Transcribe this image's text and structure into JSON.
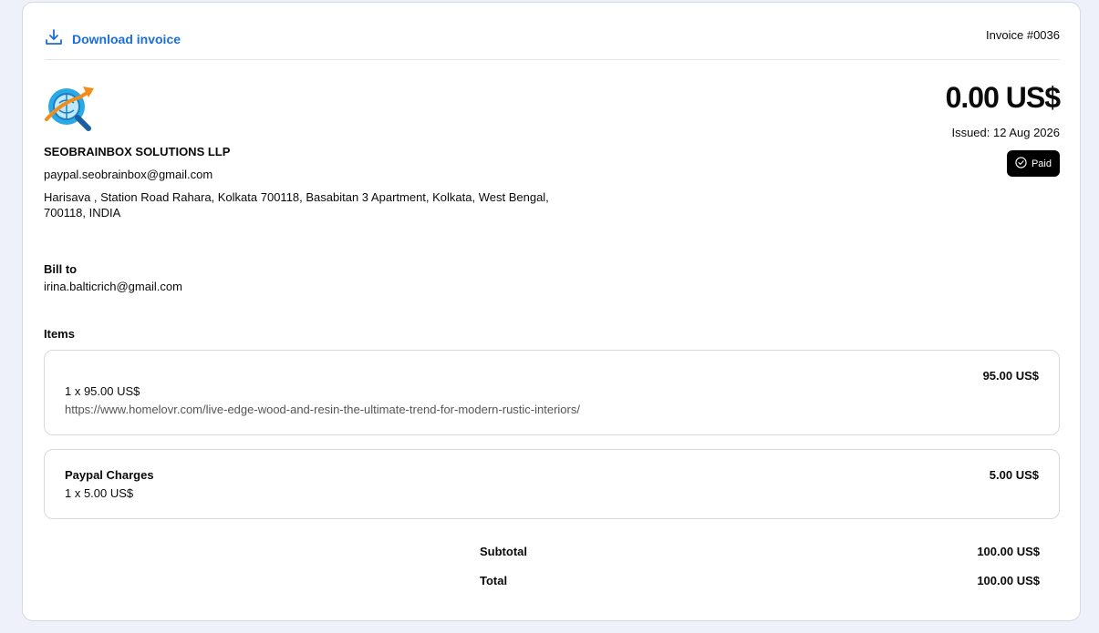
{
  "header": {
    "download_label": "Download invoice",
    "invoice_number": "Invoice #0036"
  },
  "seller": {
    "name": "SEOBRAINBOX SOLUTIONS LLP",
    "email": "paypal.seobrainbox@gmail.com",
    "address": "Harisava , Station Road Rahara, Kolkata 700118, Basabitan 3 Apartment, Kolkata, West Bengal, 700118, INDIA"
  },
  "summary": {
    "amount": "0.00 US$",
    "issued": "Issued: 12 Aug 2026",
    "status": "Paid"
  },
  "bill_to": {
    "label": "Bill to",
    "email": "irina.balticrich@gmail.com"
  },
  "items_label": "Items",
  "items": [
    {
      "name": "",
      "quantity_line": "1 x 95.00 US$",
      "description": "https://www.homelovr.com/live-edge-wood-and-resin-the-ultimate-trend-for-modern-rustic-interiors/",
      "total": "95.00 US$"
    },
    {
      "name": "Paypal Charges",
      "quantity_line": "1 x 5.00 US$",
      "description": "",
      "total": "5.00 US$"
    }
  ],
  "totals": {
    "subtotal_label": "Subtotal",
    "subtotal_value": "100.00 US$",
    "total_label": "Total",
    "total_value": "100.00 US$"
  },
  "colors": {
    "accent": "#1a6ed8",
    "badge_bg": "#000000",
    "page_bg": "#eef1fa"
  },
  "icons": {
    "download": "download-icon",
    "paid": "check-circle-icon",
    "logo": "logo-magnifier-arrow"
  }
}
